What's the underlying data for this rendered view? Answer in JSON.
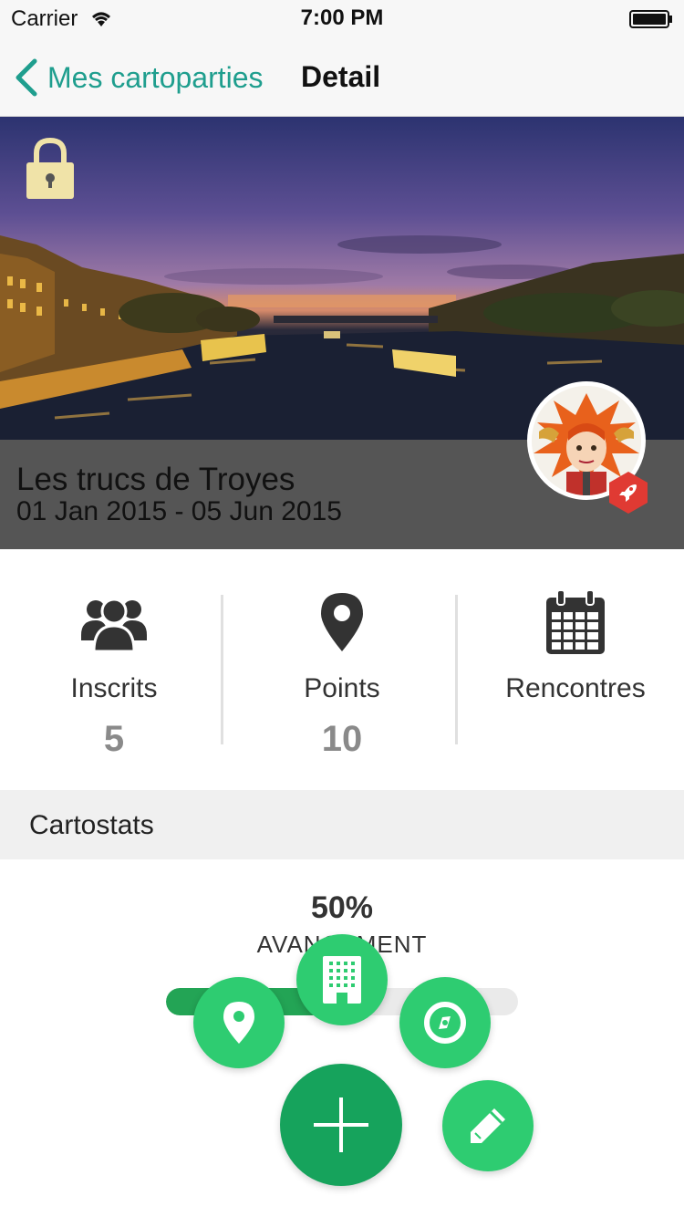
{
  "status_bar": {
    "carrier": "Carrier",
    "time": "7:00 PM"
  },
  "nav": {
    "back_label": "Mes cartoparties",
    "title": "Detail"
  },
  "hero": {
    "title": "Les trucs de Troyes",
    "dates": "01 Jan 2015 - 05 Jun 2015",
    "locked": true
  },
  "stats": [
    {
      "icon": "users-icon",
      "label": "Inscrits",
      "value": "5"
    },
    {
      "icon": "map-pin-icon",
      "label": "Points",
      "value": "10"
    },
    {
      "icon": "calendar-icon",
      "label": "Rencontres",
      "value": ""
    }
  ],
  "cartostats": {
    "section_title": "Cartostats",
    "percent_text": "50%",
    "progress_label": "AVANCEMENT",
    "progress": 0.5
  },
  "actions": [
    "plus-icon",
    "map-pin-icon",
    "building-icon",
    "compass-icon",
    "pencil-icon"
  ],
  "colors": {
    "accent": "#1f9e8e",
    "fab": "#2ecc71",
    "fab_main": "#16a35c",
    "progress": "#23a455"
  }
}
